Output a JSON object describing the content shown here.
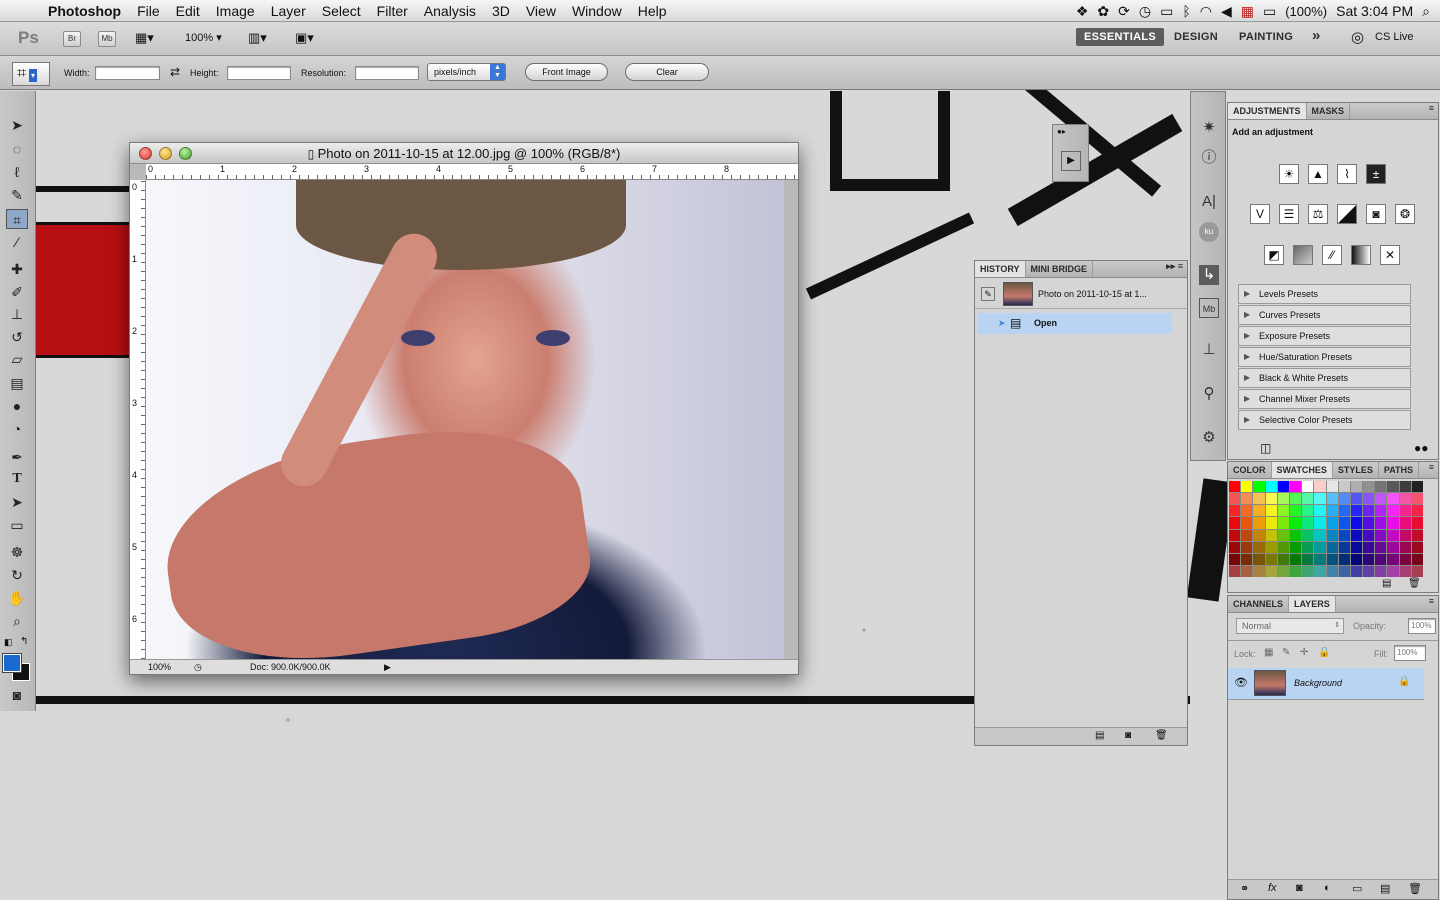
{
  "menubar": {
    "app": "Photoshop",
    "items": [
      "File",
      "Edit",
      "Image",
      "Layer",
      "Select",
      "Filter",
      "Analysis",
      "3D",
      "View",
      "Window",
      "Help"
    ],
    "battery": "(100%)",
    "clock": "Sat 3:04 PM"
  },
  "appbar": {
    "logo": "Ps",
    "br": "Br",
    "mb": "Mb",
    "zoom": "100%",
    "workspaces": [
      "ESSENTIALS",
      "DESIGN",
      "PAINTING"
    ],
    "more": "»",
    "cslive": "CS Live"
  },
  "options": {
    "width_label": "Width:",
    "height_label": "Height:",
    "resolution_label": "Resolution:",
    "units": "pixels/inch",
    "front_image": "Front Image",
    "clear": "Clear"
  },
  "document": {
    "title": "Photo on 2011-10-15 at 12.00.jpg @ 100% (RGB/8*)",
    "zoom": "100%",
    "doc_info": "Doc: 900.0K/900.0K",
    "ruler_top": [
      "0",
      "1",
      "2",
      "3",
      "4",
      "5",
      "6",
      "7",
      "8"
    ],
    "ruler_left": [
      "0",
      "1",
      "2",
      "3",
      "4",
      "5",
      "6"
    ]
  },
  "history": {
    "tabs": [
      "HISTORY",
      "MINI BRIDGE"
    ],
    "snapshot": "Photo on 2011-10-15 at 1...",
    "step": "Open"
  },
  "adjustments": {
    "tabs": [
      "ADJUSTMENTS",
      "MASKS"
    ],
    "heading": "Add an adjustment",
    "presets": [
      "Levels Presets",
      "Curves Presets",
      "Exposure Presets",
      "Hue/Saturation Presets",
      "Black & White Presets",
      "Channel Mixer Presets",
      "Selective Color Presets"
    ]
  },
  "swatches": {
    "tabs": [
      "COLOR",
      "SWATCHES",
      "STYLES",
      "PATHS"
    ]
  },
  "layers": {
    "tabs": [
      "CHANNELS",
      "LAYERS"
    ],
    "blend": "Normal",
    "opacity_label": "Opacity:",
    "opacity": "100%",
    "lock_label": "Lock:",
    "fill_label": "Fill:",
    "fill": "100%",
    "layer": "Background"
  },
  "colors": {
    "foreground": "#1a6ad0",
    "accent": "#3b88d8",
    "selection": "#b9d4f2"
  }
}
